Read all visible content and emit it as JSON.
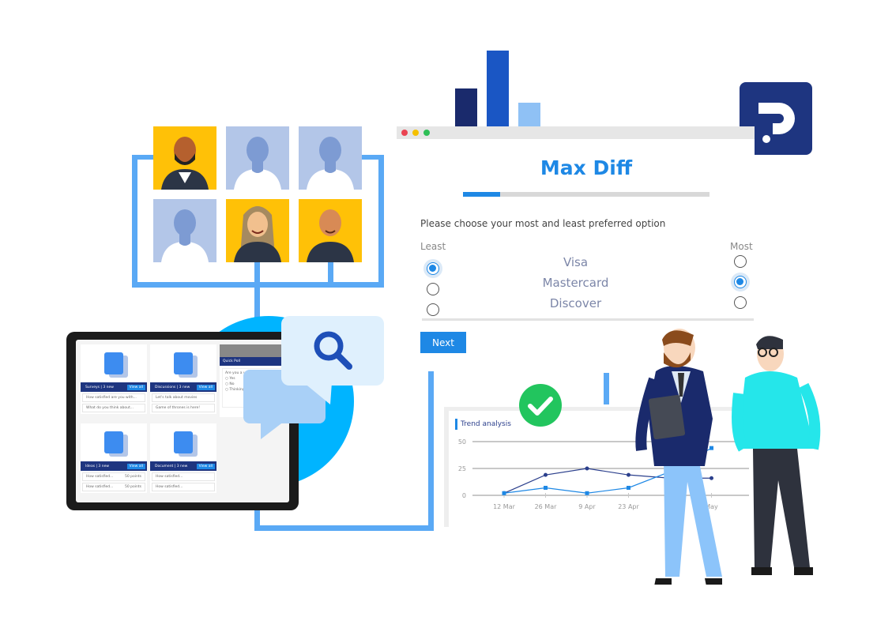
{
  "colors": {
    "accent": "#1e88e5",
    "navy": "#1e3580",
    "frame": "#5aa9f5",
    "cyan": "#00b4ff",
    "green": "#22c55e",
    "tile_person": "#ffc107",
    "tile_placeholder": "#b3c6e8"
  },
  "logo": {
    "text": "?P",
    "icon": "pollfish-logo"
  },
  "survey": {
    "title": "Max Diff",
    "progress_percent": 15,
    "prompt": "Please choose your most and least preferred option",
    "least_label": "Least",
    "most_label": "Most",
    "options": [
      {
        "label": "Visa",
        "least": true,
        "most": false
      },
      {
        "label": "Mastercard",
        "least": false,
        "most": true
      },
      {
        "label": "Discover",
        "least": false,
        "most": false
      }
    ],
    "next_label": "Next"
  },
  "tablet": {
    "cards": [
      {
        "title": "Surveys |   3 new",
        "view": "View all",
        "rows": [
          [
            "How satisfied are you with...",
            ""
          ],
          [
            "What do you think about...",
            ""
          ]
        ],
        "icon": "survey-clipboard-icon"
      },
      {
        "title": "Discussions |   3 new",
        "view": "View all",
        "rows": [
          [
            "Let's talk about movies",
            ""
          ],
          [
            "Game of thrones is here!",
            ""
          ]
        ],
        "icon": "chat-bubbles-icon"
      },
      {
        "title": "Ideas |   3 new",
        "view": "View all",
        "rows": [
          [
            "How satisfied...",
            "50 points"
          ],
          [
            "How satisfied...",
            "50 points"
          ]
        ],
        "icon": "lightbulb-icon"
      },
      {
        "title": "Document |   3 new",
        "view": "View all",
        "rows": [
          [
            "How satisfied...",
            ""
          ],
          [
            "How satisfied...",
            ""
          ]
        ],
        "icon": "folder-document-icon"
      }
    ],
    "poll": {
      "title": "Quick Poll",
      "question": "Are you a veg...",
      "options": [
        "Yes",
        "No",
        "Thinking a..."
      ]
    }
  },
  "chart_data": {
    "type": "line",
    "title": "Trend analysis",
    "categories": [
      "12 Mar",
      "26 Mar",
      "9 Apr",
      "23 Apr",
      "",
      "May"
    ],
    "ylim": [
      0,
      50
    ],
    "yticks": [
      0,
      25,
      50
    ],
    "grid": true,
    "series": [
      {
        "color": "#2b3f8c",
        "marker": "circle",
        "values": [
          2,
          19,
          25,
          19,
          16,
          16
        ]
      },
      {
        "color": "#1e88e5",
        "marker": "square",
        "values": [
          2,
          7,
          2,
          7,
          22,
          44
        ]
      }
    ]
  }
}
